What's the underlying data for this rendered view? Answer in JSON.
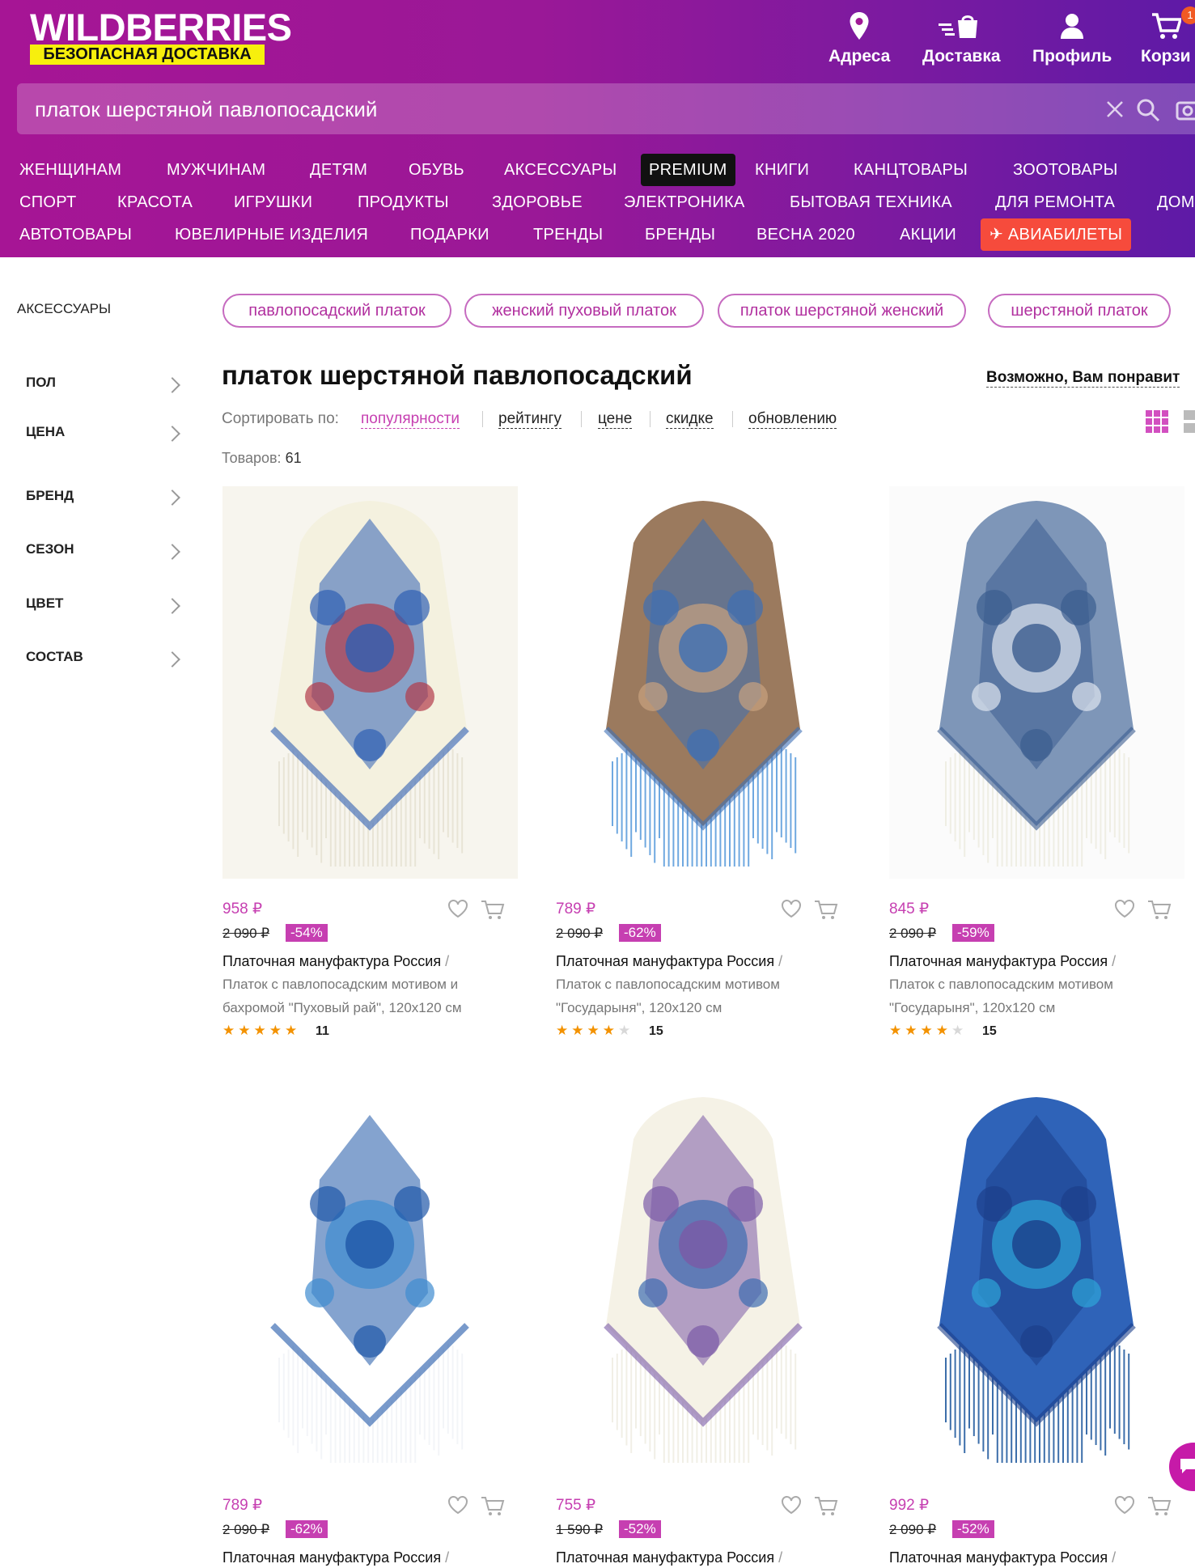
{
  "header": {
    "logo": "WILDBERRIES",
    "logo_sub": "БЕЗОПАСНАЯ ДОСТАВКА",
    "nav": [
      {
        "label": "Адреса",
        "icon": "location-pin-icon"
      },
      {
        "label": "Доставка",
        "icon": "delivery-bag-icon"
      },
      {
        "label": "Профиль",
        "icon": "user-icon"
      },
      {
        "label": "Корзи",
        "icon": "cart-icon"
      }
    ],
    "cart_badge": "1"
  },
  "search": {
    "value": "платок шерстяной павлопосадский"
  },
  "categories": {
    "row1": [
      "ЖЕНЩИНАМ",
      "МУЖЧИНАМ",
      "ДЕТЯМ",
      "ОБУВЬ",
      "АКСЕССУАРЫ",
      "PREMIUM",
      "КНИГИ",
      "КАНЦТОВАРЫ",
      "ЗООТОВАРЫ"
    ],
    "row2": [
      "СПОРТ",
      "КРАСОТА",
      "ИГРУШКИ",
      "ПРОДУКТЫ",
      "ЗДОРОВЬЕ",
      "ЭЛЕКТРОНИКА",
      "БЫТОВАЯ ТЕХНИКА",
      "ДЛЯ РЕМОНТА",
      "ДОМ"
    ],
    "row3": [
      "АВТОТОВАРЫ",
      "ЮВЕЛИРНЫЕ ИЗДЕЛИЯ",
      "ПОДАРКИ",
      "ТРЕНДЫ",
      "БРЕНДЫ",
      "ВЕСНА 2020",
      "АКЦИИ",
      "АВИАБИЛЕТЫ"
    ]
  },
  "sidebar": {
    "crumb": "АКСЕССУАРЫ",
    "filters": [
      "ПОЛ",
      "ЦЕНА",
      "БРЕНД",
      "СЕЗОН",
      "ЦВЕТ",
      "СОСТАВ"
    ]
  },
  "chips": [
    "павлопосадский платок",
    "женский пуховый платок",
    "платок шерстяной женский",
    "шерстяной платок"
  ],
  "main": {
    "title": "платок шерстяной павлопосадский",
    "maybe_like": "Возможно, Вам понравит",
    "sort_label": "Сортировать по:",
    "sort_options": [
      "популярности",
      "рейтингу",
      "цене",
      "скидке",
      "обновлению"
    ],
    "count_label": "Товаров:",
    "count": "61"
  },
  "products": [
    {
      "price": "958 ₽",
      "old_price": "2 090 ₽",
      "discount": "-54%",
      "brand": "Платочная мануфактура Россия",
      "desc": "Платок с павлопосадским мотивом и бахромой \"Пуховый рай\", 120х120 см",
      "rating": 5,
      "reviews": "11",
      "palette": {
        "bg": "#f7f5ee",
        "base": "#f4f1df",
        "a": "#2f5fb3",
        "b": "#b23a4a",
        "fringe": "#e8e4d6"
      }
    },
    {
      "price": "789 ₽",
      "old_price": "2 090 ₽",
      "discount": "-62%",
      "brand": "Платочная мануфактура Россия",
      "desc": "Платок с павлопосадским мотивом \"Государыня\", 120х120 см",
      "rating": 4,
      "reviews": "15",
      "palette": {
        "bg": "#ffffff",
        "base": "#9b7a5e",
        "a": "#3d6fb5",
        "b": "#c9a27f",
        "fringe": "#6fa8e0"
      }
    },
    {
      "price": "845 ₽",
      "old_price": "2 090 ₽",
      "discount": "-59%",
      "brand": "Платочная мануфактура Россия",
      "desc": "Платок с павлопосадским мотивом \"Государыня\", 120х120 см",
      "rating": 4,
      "reviews": "15",
      "palette": {
        "bg": "#fbfbfb",
        "base": "#7e96b8",
        "a": "#3b5c8f",
        "b": "#dfe6ef",
        "fringe": "#efeee4"
      }
    },
    {
      "price": "789 ₽",
      "old_price": "2 090 ₽",
      "discount": "-62%",
      "brand": "Платочная мануфактура Россия",
      "desc": "",
      "rating": 0,
      "reviews": "",
      "palette": {
        "bg": "#ffffff",
        "base": "#ffffff",
        "a": "#1f57a8",
        "b": "#3f8bd0",
        "fringe": "#f3f5f8"
      }
    },
    {
      "price": "755 ₽",
      "old_price": "1 590 ₽",
      "discount": "-52%",
      "brand": "Платочная мануфактура Россия",
      "desc": "",
      "rating": 0,
      "reviews": "",
      "palette": {
        "bg": "#ffffff",
        "base": "#f5f2e6",
        "a": "#7a5aa6",
        "b": "#3d6cb0",
        "fringe": "#f1efe6"
      }
    },
    {
      "price": "992 ₽",
      "old_price": "2 090 ₽",
      "discount": "-52%",
      "brand": "Платочная мануфактура Россия",
      "desc": "",
      "rating": 0,
      "reviews": "",
      "palette": {
        "bg": "#ffffff",
        "base": "#2f63b8",
        "a": "#1c3f8a",
        "b": "#2ea5d8",
        "fringe": "#3c6eaa"
      }
    }
  ],
  "colors": {
    "accent": "#c63fb1",
    "brand_purple": "#a61595",
    "avia": "#f64b3c",
    "logo_yellow": "#f7ef0d"
  }
}
